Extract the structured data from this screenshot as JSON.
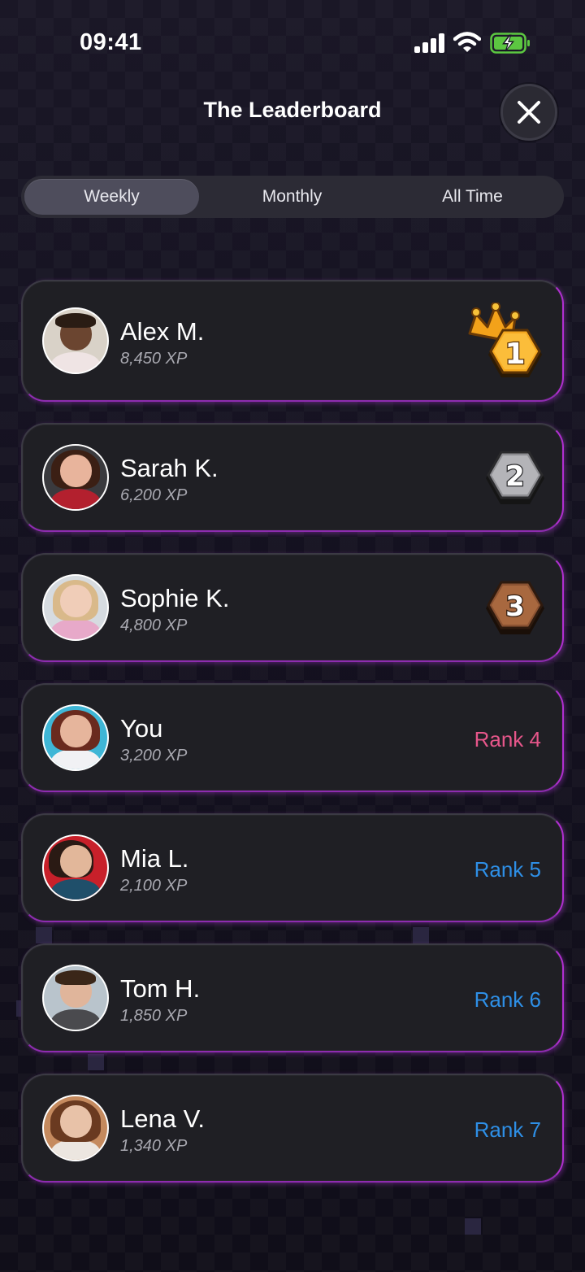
{
  "status_bar": {
    "time": "09:41"
  },
  "header": {
    "title": "The Leaderboard"
  },
  "tabs": [
    {
      "label": "Weekly",
      "active": true
    },
    {
      "label": "Monthly",
      "active": false
    },
    {
      "label": "All Time",
      "active": false
    }
  ],
  "colors": {
    "accent_border": "#b02fd0",
    "you_rank": "#e6568a",
    "rank": "#2e8fe6",
    "gold": "#f3a21a",
    "silver": "#9a9a9e",
    "bronze": "#8e5538"
  },
  "entries": [
    {
      "name": "Alex M.",
      "xp": "8,450 XP",
      "badge": "crown-rank-1-badge",
      "badge_number": "1"
    },
    {
      "name": "Sarah K.",
      "xp": "6,200 XP",
      "badge": "silver-rank-2-badge",
      "badge_number": "2"
    },
    {
      "name": "Sophie K.",
      "xp": "4,800 XP",
      "badge": "bronze-rank-3-badge",
      "badge_number": "3"
    },
    {
      "name": "You",
      "xp": "3,200 XP",
      "rank_label": "Rank 4"
    },
    {
      "name": "Mia L.",
      "xp": "2,100 XP",
      "rank_label": "Rank 5"
    },
    {
      "name": "Tom H.",
      "xp": "1,850 XP",
      "rank_label": "Rank 6"
    },
    {
      "name": "Lena V.",
      "xp": "1,340 XP",
      "rank_label": "Rank 7"
    }
  ]
}
